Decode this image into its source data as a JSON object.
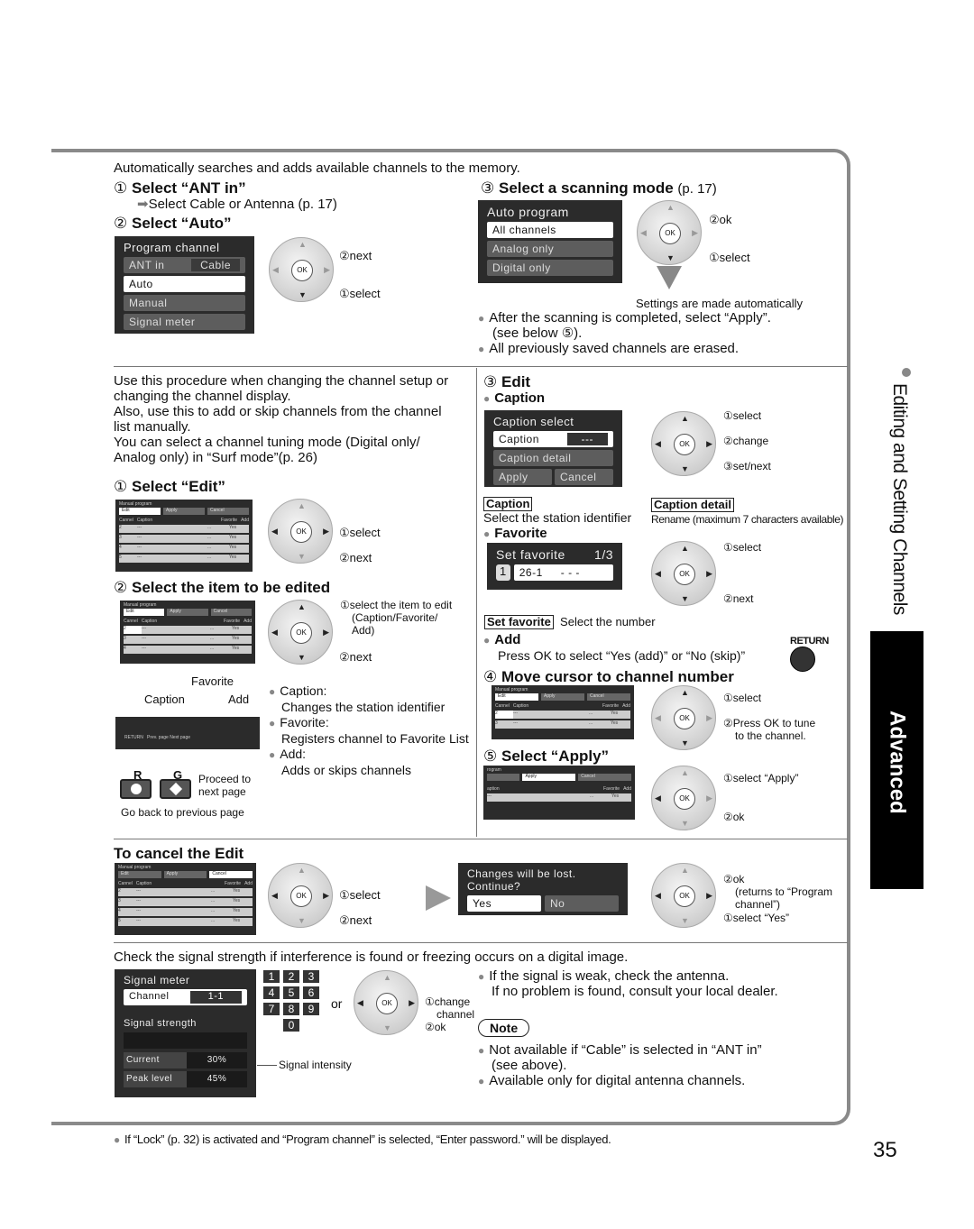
{
  "intro": "Automatically searches and adds available channels to the memory.",
  "auto": {
    "step1": {
      "num": "①",
      "title": "Select “ANT in”",
      "sub": "Select Cable or Antenna (p. 17)"
    },
    "step2": {
      "num": "②",
      "title": "Select “Auto”"
    },
    "program_menu": {
      "title": "Program channel",
      "ant_label": "ANT in",
      "ant_value": "Cable",
      "items": [
        "Auto",
        "Manual",
        "Signal meter"
      ]
    },
    "pad1": {
      "next": "②next",
      "select": "①select"
    },
    "step3": {
      "num": "③",
      "title": "Select a scanning mode",
      "ref": "(p. 17)"
    },
    "auto_menu": {
      "title": "Auto program",
      "items": [
        "All channels",
        "Analog only",
        "Digital only"
      ]
    },
    "pad2": {
      "ok": "②ok",
      "select": "①select"
    },
    "auto_note": "Settings are made automatically",
    "bullets": [
      "After the scanning is completed, select “Apply”.",
      "(see below ⑤).",
      "All previously saved channels are erased."
    ]
  },
  "manual": {
    "intro": [
      "Use this procedure when changing the channel setup or",
      "changing the channel display.",
      "Also, use this to add or skip channels from the channel",
      "list manually.",
      "You can select a channel tuning mode (Digital only/",
      "Analog only) in “Surf mode”(p. 26)"
    ],
    "step1": {
      "num": "①",
      "title": "Select “Edit”",
      "select": "①select",
      "next": "②next"
    },
    "step2": {
      "num": "②",
      "title": "Select the item to be edited",
      "select": "①select the item to edit",
      "select2": "(Caption/Favorite/",
      "select3": "Add)",
      "next": "②next",
      "lbl_caption": "Caption",
      "lbl_favorite": "Favorite",
      "lbl_add": "Add"
    },
    "table": {
      "title": "Manual program",
      "buttons": [
        "Edit",
        "Apply",
        "Cancel"
      ],
      "headers": [
        "Cannel",
        "Caption",
        "Favorite",
        "Add"
      ],
      "rows": [
        [
          "2",
          "---",
          "...",
          "Yes"
        ],
        [
          "3",
          "---",
          "...",
          "Yes"
        ],
        [
          "4",
          "---",
          "...",
          "Yes"
        ],
        [
          "5",
          "---",
          "...",
          "Yes"
        ]
      ]
    },
    "footer_bar": {
      "return": "RETURN",
      "prev": "Prev. page",
      "next": "Next page"
    },
    "item_bullets": [
      {
        "label": "Caption:",
        "desc": "Changes the station identifier"
      },
      {
        "label": "Favorite:",
        "desc": "Registers channel to Favorite List"
      },
      {
        "label": "Add:",
        "desc": "Adds or skips channels"
      }
    ],
    "buttons": {
      "r": "R",
      "g": "G",
      "proceed": "Proceed to",
      "proceed2": "next page",
      "back": "Go back to previous page"
    },
    "step3": {
      "num": "③",
      "title": "Edit",
      "caption_h": "Caption",
      "caption_menu": {
        "title": "Caption select",
        "row_label": "Caption",
        "row_value": "---",
        "detail": "Caption detail",
        "apply": "Apply",
        "cancel": "Cancel"
      },
      "caption_pad": {
        "select": "①select",
        "change": "②change",
        "setnext": "③set/next"
      },
      "caption_box": "Caption",
      "caption_desc": "Select the station identifier",
      "detail_box": "Caption detail",
      "detail_desc": "Rename (maximum 7 characters available)",
      "favorite_h": "Favorite",
      "fav_menu": {
        "title": "Set favorite",
        "page": "1/3",
        "num": "1",
        "value": "26-1",
        "dashes": "- - -"
      },
      "fav_pad": {
        "select": "①select",
        "next": "②next"
      },
      "setfav_box": "Set favorite",
      "setfav_desc": "Select the number",
      "add_h": "Add",
      "add_desc": "Press OK to select “Yes (add)” or “No (skip)”",
      "return_label": "RETURN"
    },
    "step4": {
      "num": "④",
      "title": "Move cursor to channel number",
      "select": "①select",
      "press": "②Press OK to tune",
      "press2": "to the channel."
    },
    "step5": {
      "num": "⑤",
      "title": "Select “Apply”",
      "select": "①select “Apply”",
      "ok": "②ok",
      "table_title": "rogram",
      "caption_col": "aption"
    }
  },
  "cancel": {
    "title": "To cancel the Edit",
    "select": "①select",
    "next": "②next",
    "dialog": {
      "text": "Changes will be lost. Continue?",
      "yes": "Yes",
      "no": "No"
    },
    "ok": "②ok",
    "returns": "(returns to “Program",
    "returns2": "channel”)",
    "select_yes": "①select “Yes”"
  },
  "signal": {
    "intro": "Check the signal strength if interference is found or freezing occurs on a digital image.",
    "menu": {
      "title": "Signal  meter",
      "channel_label": "Channel",
      "channel_value": "1-1",
      "strength": "Signal  strength",
      "current_label": "Current",
      "current": "30%",
      "peak_label": "Peak level",
      "peak": "45%"
    },
    "keys": [
      "1",
      "2",
      "3",
      "4",
      "5",
      "6",
      "7",
      "8",
      "9",
      "0"
    ],
    "or": "or",
    "change": "①change",
    "change2": "channel",
    "ok": "②ok",
    "intensity": "Signal intensity",
    "bullet1": "If the signal is weak, check the antenna.",
    "bullet1b": "If no problem is found, consult your local dealer.",
    "note": "Note",
    "note1": "Not available if “Cable” is selected in “ANT in”",
    "note1b": "(see above).",
    "note2": "Available only for digital antenna channels."
  },
  "side": {
    "section": "Editing and Setting Channels",
    "tab": "Advanced"
  },
  "footer": {
    "note": "If “Lock” (p. 32) is activated and “Program channel” is selected, “Enter password.” will be displayed.",
    "page": "35"
  }
}
